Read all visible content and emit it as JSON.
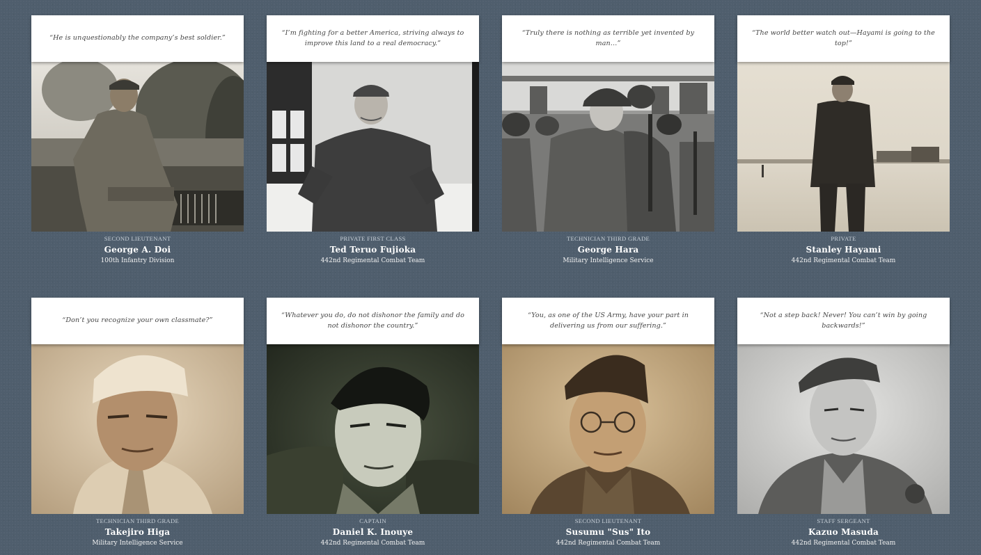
{
  "soldiers": [
    {
      "quote": "“He is unquestionably the company’s best soldier.”",
      "rank": "SECOND LIEUTENANT",
      "name": "George A. Doi",
      "unit": "100th Infantry Division",
      "photo_tone": "sepia-gray"
    },
    {
      "quote": "“I’m fighting for a better America, striving always to improve this land to a real democracy.”",
      "rank": "PRIVATE FIRST CLASS",
      "name": "Ted Teruo Fujioka",
      "unit": "442nd Regimental Combat Team",
      "photo_tone": "black-white"
    },
    {
      "quote": "“Truly there is nothing as terrible yet invented by man…”",
      "rank": "TECHNICIAN THIRD GRADE",
      "name": "George Hara",
      "unit": "Military Intelligence Service",
      "photo_tone": "black-white"
    },
    {
      "quote": "“The world better watch out—Hayami is going to the top!”",
      "rank": "PRIVATE",
      "name": "Stanley Hayami",
      "unit": "442nd Regimental Combat Team",
      "photo_tone": "pale-sepia"
    },
    {
      "quote": "“Don’t you recognize your own classmate?”",
      "rank": "TECHNICIAN THIRD GRADE",
      "name": "Takejiro Higa",
      "unit": "Military Intelligence Service",
      "photo_tone": "warm-sepia"
    },
    {
      "quote": "“Whatever you do, do not dishonor the family and do not dishonor the country.”",
      "rank": "CAPTAIN",
      "name": "Daniel K. Inouye",
      "unit": "442nd Regimental Combat Team",
      "photo_tone": "dark-green"
    },
    {
      "quote": "“You, as one of the US Army, have your part in delivering us from our suffering.”",
      "rank": "SECOND LIEUTENANT",
      "name": "Susumu \"Sus\" Ito",
      "unit": "442nd Regimental Combat Team",
      "photo_tone": "warm-sepia"
    },
    {
      "quote": "“Not a step back! Never! You can’t win by going backwards!”",
      "rank": "STAFF SERGEANT",
      "name": "Kazuo Masuda",
      "unit": "442nd Regimental Combat Team",
      "photo_tone": "black-white"
    }
  ],
  "colors": {
    "background": "#4f5e6d",
    "card": "#ffffff",
    "rank_text": "#c8d0d8",
    "name_text": "#ffffff"
  }
}
